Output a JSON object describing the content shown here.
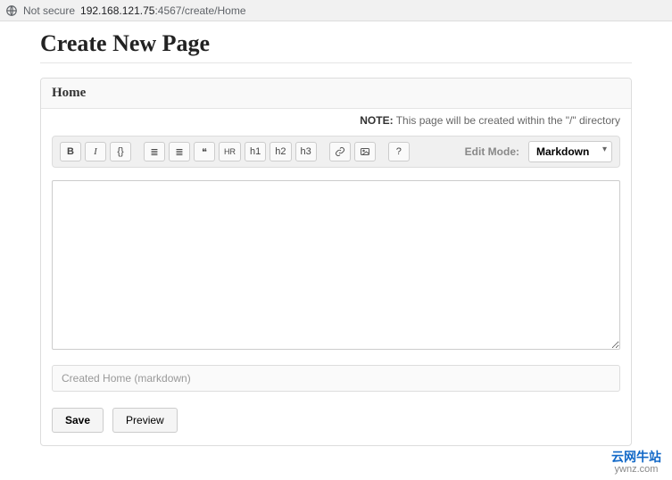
{
  "browser": {
    "security_label": "Not secure",
    "url_host": "192.168.121.75",
    "url_rest": ":4567/create/Home"
  },
  "page": {
    "title": "Create New Page",
    "page_name": "Home",
    "note_label": "NOTE:",
    "note_text": " This page will be created within the \"/\" directory"
  },
  "toolbar": {
    "bold": "B",
    "italic": "I",
    "code": "{}",
    "ul": "≣",
    "ol": "≣",
    "quote": "❝",
    "hr": "HR",
    "h1": "h1",
    "h2": "h2",
    "h3": "h3",
    "help": "?",
    "mode_label": "Edit Mode:",
    "mode_value": "Markdown"
  },
  "editor": {
    "content": "",
    "commit_placeholder": "Created Home (markdown)"
  },
  "buttons": {
    "save": "Save",
    "preview": "Preview"
  },
  "watermark": {
    "line1": "云网牛站",
    "line2": "ywnz.com"
  }
}
